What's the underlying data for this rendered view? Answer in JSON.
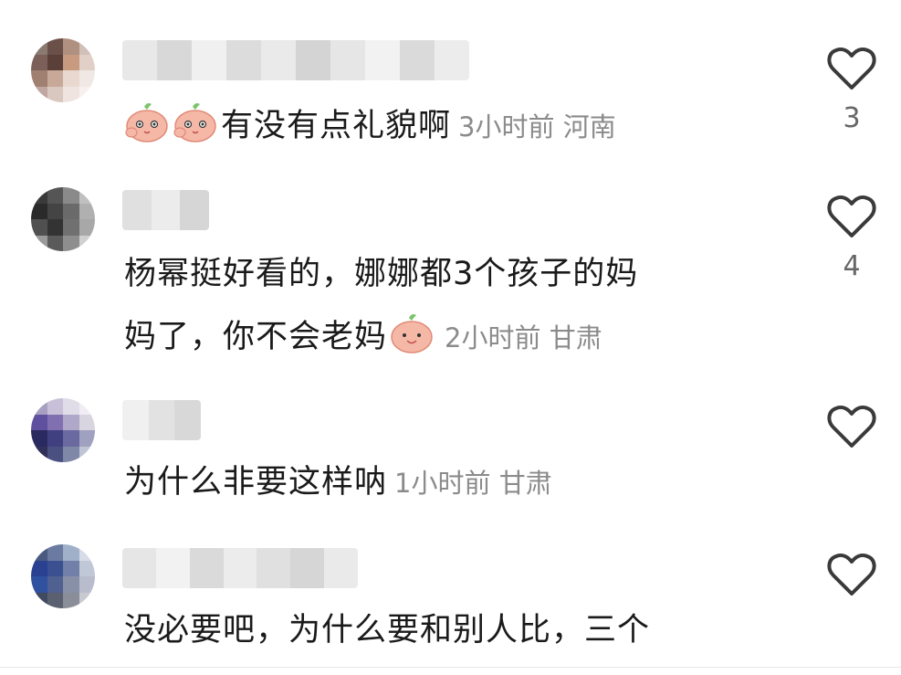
{
  "comments": [
    {
      "text": "有没有点礼貌啊",
      "time": "3小时前",
      "location": "河南",
      "likes": "3",
      "emoji_count": 2
    },
    {
      "text_line1": "杨幂挺好看的，娜娜都3个孩子的妈",
      "text_line2": "妈了，你不会老妈",
      "time": "2小时前",
      "location": "甘肃",
      "likes": "4"
    },
    {
      "text": "为什么非要这样呐",
      "time": "1小时前",
      "location": "甘肃",
      "likes": ""
    },
    {
      "text": "没必要吧，为什么要和别人比，三个",
      "likes": ""
    }
  ],
  "icons": {
    "like": "heart-outline-icon",
    "emoji": "peach-face-emoji"
  },
  "colors": {
    "text": "#1a1a1a",
    "meta": "#8b8b8b",
    "like_icon": "#3a3a3a"
  }
}
